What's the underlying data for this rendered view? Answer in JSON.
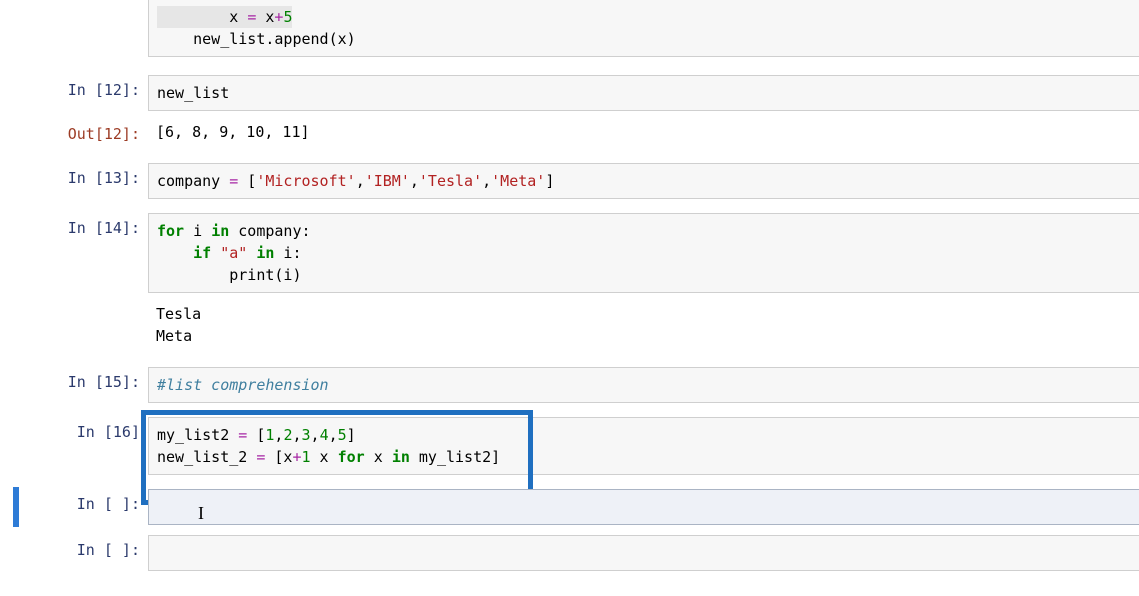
{
  "cells": {
    "c0": {
      "code": {
        "l1a": "        x ",
        "l1b": "=",
        "l1c": " x",
        "l1d": "+",
        "l1e": "5",
        "l2a": "    new_list.append(x)"
      }
    },
    "c12": {
      "prompt_in": "In [12]:",
      "prompt_out": "Out[12]:",
      "code": "new_list",
      "output": "[6, 8, 9, 10, 11]"
    },
    "c13": {
      "prompt": "In [13]:",
      "code": {
        "a": "company ",
        "b": "=",
        "c": " [",
        "s1": "'Microsoft'",
        "s2": "'IBM'",
        "s3": "'Tesla'",
        "s4": "'Meta'",
        "d": ",",
        "e": "]"
      }
    },
    "c14": {
      "prompt": "In [14]:",
      "code": {
        "kw_for": "for",
        "sp": " ",
        "i": "i",
        "kw_in": "in",
        "company": " company:",
        "kw_if": "if",
        "str_a": "\"a\"",
        "kw_in2": "in",
        "i2": " i:",
        "pr": "print",
        "par": "(i)",
        "indent1": " ",
        "indent4": "    ",
        "indent8": "        "
      },
      "output": "Tesla\nMeta"
    },
    "c15": {
      "prompt": "In [15]:",
      "comment": "#list comprehension"
    },
    "c16": {
      "prompt": "In [16]",
      "code": {
        "l1_a": "my_list2 ",
        "l1_b": "=",
        "l1_c": " [",
        "n1": "1",
        "n2": "2",
        "n3": "3",
        "n4": "4",
        "n5": "5",
        "comma": ",",
        "rb": "]",
        "l2_a": "new_list_2 ",
        "l2_b": "=",
        "l2_c": " [x",
        "l2_d": "+",
        "l2_e": "1",
        "kw_for": "for",
        "kw_in": "in",
        "l2_f": " x ",
        "l2_g": " my_list2]"
      }
    },
    "empty1": {
      "prompt": "In [ ]:"
    },
    "empty2": {
      "prompt": "In [ ]:"
    }
  }
}
